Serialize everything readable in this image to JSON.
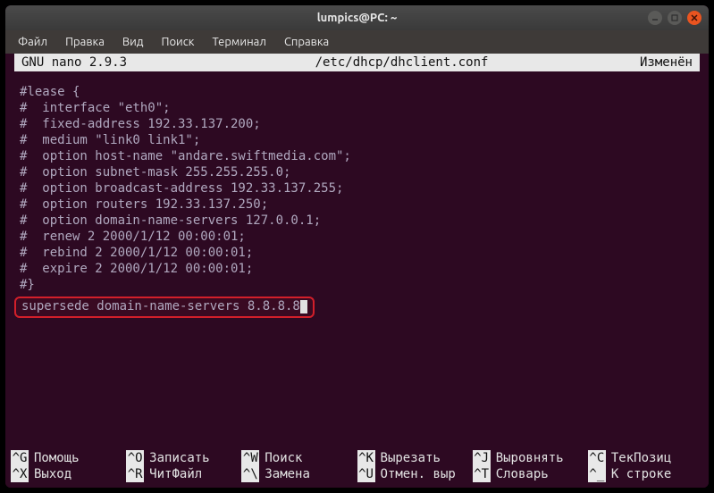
{
  "titlebar": {
    "title": "lumpics@PC: ~"
  },
  "menubar": {
    "items": [
      "Файл",
      "Правка",
      "Вид",
      "Поиск",
      "Терминал",
      "Справка"
    ]
  },
  "nanobar": {
    "app": "  GNU nano 2.9.3",
    "file": "/etc/dhcp/dhclient.conf",
    "status": "Изменён"
  },
  "content": "#lease {\n#  interface \"eth0\";\n#  fixed-address 192.33.137.200;\n#  medium \"link0 link1\";\n#  option host-name \"andare.swiftmedia.com\";\n#  option subnet-mask 255.255.255.0;\n#  option broadcast-address 192.33.137.255;\n#  option routers 192.33.137.250;\n#  option domain-name-servers 127.0.0.1;\n#  renew 2 2000/1/12 00:00:01;\n#  rebind 2 2000/1/12 00:00:01;\n#  expire 2 2000/1/12 00:00:01;\n#}",
  "highlighted_line": "supersede domain-name-servers 8.8.8.8",
  "shortcuts": {
    "row1": [
      {
        "key": "^G",
        "label": "Помощь"
      },
      {
        "key": "^O",
        "label": "Записать"
      },
      {
        "key": "^W",
        "label": "Поиск"
      },
      {
        "key": "^K",
        "label": "Вырезать"
      },
      {
        "key": "^J",
        "label": "Выровнять"
      },
      {
        "key": "^C",
        "label": "ТекПозиц"
      }
    ],
    "row2": [
      {
        "key": "^X",
        "label": "Выход"
      },
      {
        "key": "^R",
        "label": "ЧитФайл"
      },
      {
        "key": "^\\",
        "label": "Замена"
      },
      {
        "key": "^U",
        "label": "Отмен. выр"
      },
      {
        "key": "^T",
        "label": "Словарь"
      },
      {
        "key": "^_",
        "label": "К строке"
      }
    ]
  }
}
